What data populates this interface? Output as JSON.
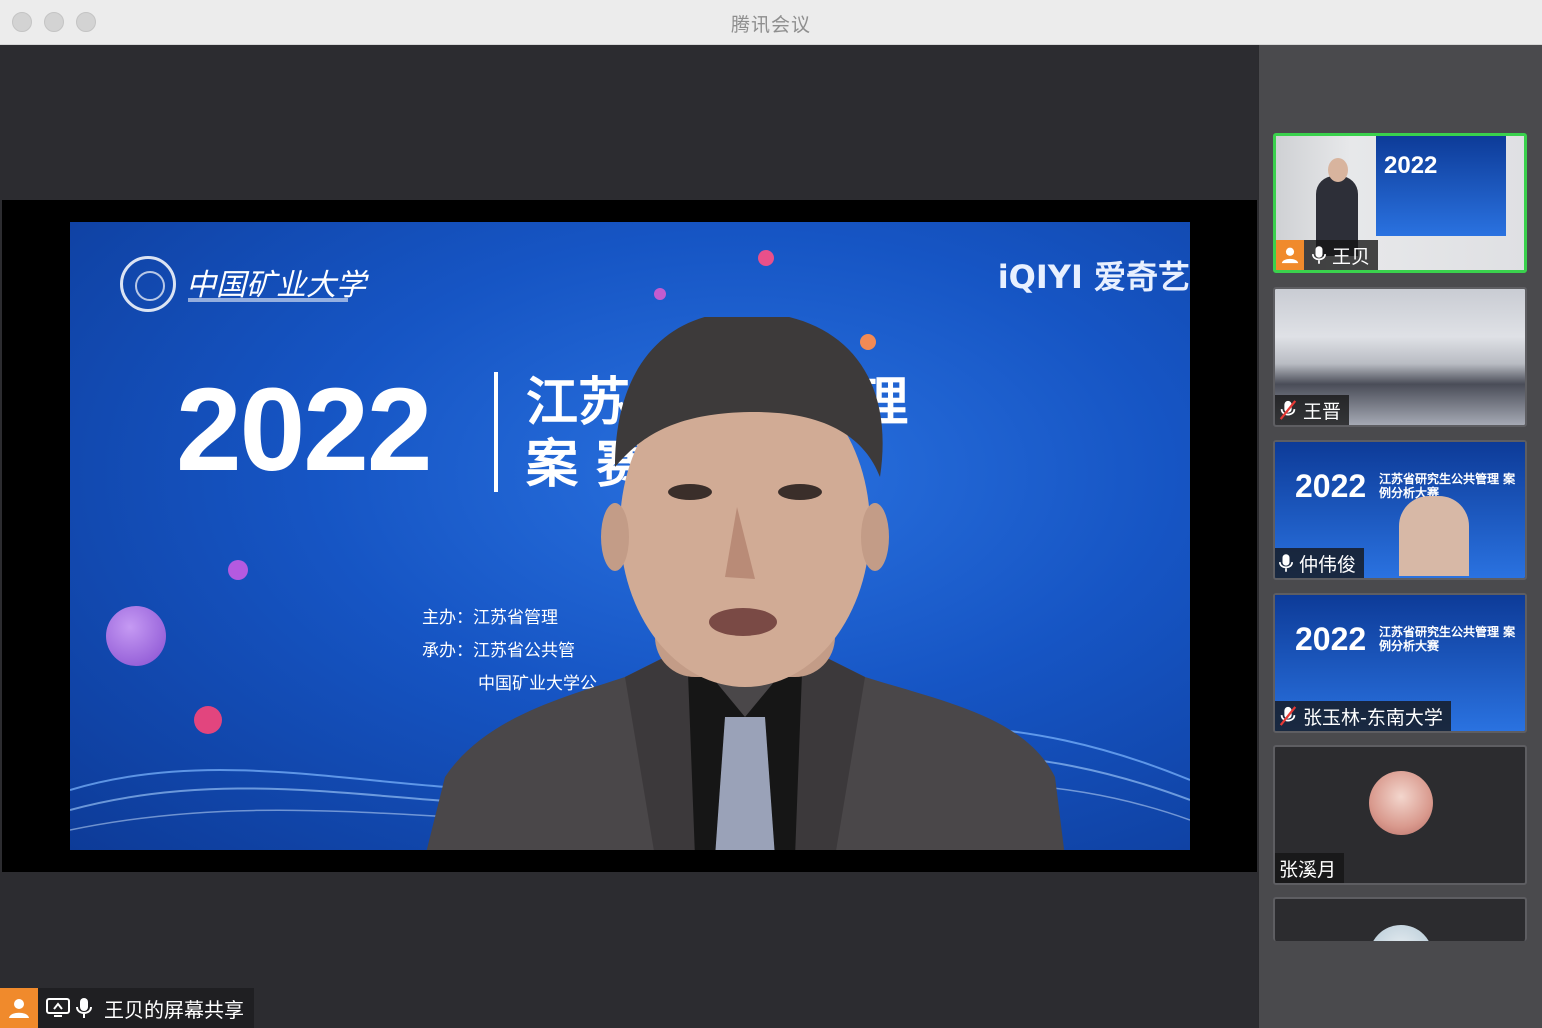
{
  "window": {
    "title": "腾讯会议"
  },
  "slide": {
    "university": "中国矿业大学",
    "brand": "iQIYI 爱奇艺",
    "year": "2022",
    "title_line1": "江苏      生公共管理",
    "title_line2": "案          赛",
    "org_lines": [
      "主办：江苏省管理",
      "承办：江苏省公共管",
      "中国矿业大学公"
    ]
  },
  "share_badge": {
    "label": "王贝的屏幕共享"
  },
  "participants": [
    {
      "name": "王贝",
      "mic": "on",
      "active": true,
      "avatar_icon": "person-icon"
    },
    {
      "name": "王晋",
      "mic": "muted",
      "active": false
    },
    {
      "name": "仲伟俊",
      "mic": "on",
      "active": false
    },
    {
      "name": "张玉林-东南大学",
      "mic": "muted",
      "active": false
    },
    {
      "name": "张溪月",
      "mic": "none",
      "active": false
    }
  ],
  "tile_slide": {
    "year": "2022",
    "title": "江苏省研究生公共管理 案例分析大赛"
  },
  "colors": {
    "active_border": "#3ad14d",
    "avatar_orange": "#f08a2c",
    "slide_blue": "#1655c4"
  }
}
